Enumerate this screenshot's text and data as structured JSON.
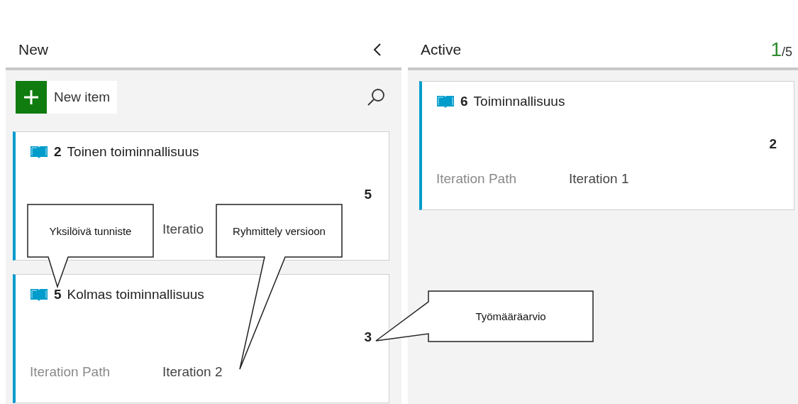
{
  "columns": [
    {
      "title": "New",
      "collapsible": true,
      "new_item_button": {
        "label": "New item"
      },
      "search": true,
      "cards": [
        {
          "id": "2",
          "title": "Toinen toiminnallisuus",
          "estimate": "5",
          "field": {
            "value": "Iteratio"
          }
        },
        {
          "id": "5",
          "title": "Kolmas toiminnallisuus",
          "estimate": "3",
          "field": {
            "label": "Iteration Path",
            "value": "Iteration 2"
          }
        }
      ]
    },
    {
      "title": "Active",
      "count": "1",
      "limit": "/5",
      "cards": [
        {
          "id": "6",
          "title": "Toiminnallisuus",
          "estimate": "2",
          "field": {
            "label": "Iteration Path",
            "value": "Iteration 1"
          }
        }
      ]
    }
  ],
  "callouts": [
    {
      "text": "Yksilöivä tunniste"
    },
    {
      "text": "Ryhmittely versioon"
    },
    {
      "text": "Työmääräarvio"
    }
  ]
}
